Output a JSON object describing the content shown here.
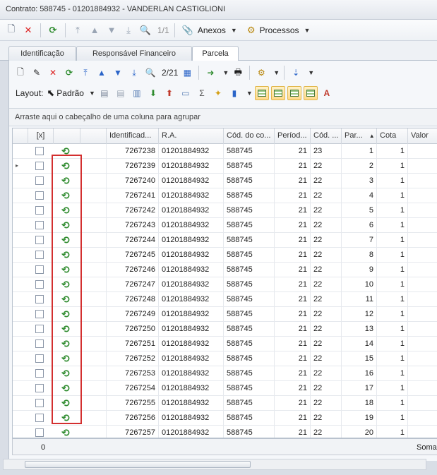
{
  "window": {
    "title": "Contrato: 588745 - 01201884932 - VANDERLAN CASTIGLIONI"
  },
  "toolbar1": {
    "counter": "1/1",
    "anexos_label": "Anexos",
    "processos_label": "Processos"
  },
  "tabs": [
    {
      "label": "Identificação"
    },
    {
      "label": "Responsável Financeiro"
    },
    {
      "label": "Parcela"
    }
  ],
  "toolbar2": {
    "counter": "2/21"
  },
  "toolbar3": {
    "layout_label": "Layout:",
    "layout_value": "Padrão"
  },
  "grid": {
    "group_hint": "Arraste aqui o cabeçalho de uma coluna para agrupar",
    "columns": [
      "[x]",
      "",
      "Identificad...",
      "R.A.",
      "Cód. do co...",
      "Períod...",
      "Cód. ...",
      "Par...",
      "Cota",
      "Valor"
    ],
    "rows": [
      {
        "id": "7267238",
        "ra": "01201884932",
        "cod": "588745",
        "per": "21",
        "cod2": "23",
        "par": "1",
        "cota": "1"
      },
      {
        "id": "7267239",
        "ra": "01201884932",
        "cod": "588745",
        "per": "21",
        "cod2": "22",
        "par": "2",
        "cota": "1"
      },
      {
        "id": "7267240",
        "ra": "01201884932",
        "cod": "588745",
        "per": "21",
        "cod2": "22",
        "par": "3",
        "cota": "1"
      },
      {
        "id": "7267241",
        "ra": "01201884932",
        "cod": "588745",
        "per": "21",
        "cod2": "22",
        "par": "4",
        "cota": "1"
      },
      {
        "id": "7267242",
        "ra": "01201884932",
        "cod": "588745",
        "per": "21",
        "cod2": "22",
        "par": "5",
        "cota": "1"
      },
      {
        "id": "7267243",
        "ra": "01201884932",
        "cod": "588745",
        "per": "21",
        "cod2": "22",
        "par": "6",
        "cota": "1"
      },
      {
        "id": "7267244",
        "ra": "01201884932",
        "cod": "588745",
        "per": "21",
        "cod2": "22",
        "par": "7",
        "cota": "1"
      },
      {
        "id": "7267245",
        "ra": "01201884932",
        "cod": "588745",
        "per": "21",
        "cod2": "22",
        "par": "8",
        "cota": "1"
      },
      {
        "id": "7267246",
        "ra": "01201884932",
        "cod": "588745",
        "per": "21",
        "cod2": "22",
        "par": "9",
        "cota": "1"
      },
      {
        "id": "7267247",
        "ra": "01201884932",
        "cod": "588745",
        "per": "21",
        "cod2": "22",
        "par": "10",
        "cota": "1"
      },
      {
        "id": "7267248",
        "ra": "01201884932",
        "cod": "588745",
        "per": "21",
        "cod2": "22",
        "par": "11",
        "cota": "1"
      },
      {
        "id": "7267249",
        "ra": "01201884932",
        "cod": "588745",
        "per": "21",
        "cod2": "22",
        "par": "12",
        "cota": "1"
      },
      {
        "id": "7267250",
        "ra": "01201884932",
        "cod": "588745",
        "per": "21",
        "cod2": "22",
        "par": "13",
        "cota": "1"
      },
      {
        "id": "7267251",
        "ra": "01201884932",
        "cod": "588745",
        "per": "21",
        "cod2": "22",
        "par": "14",
        "cota": "1"
      },
      {
        "id": "7267252",
        "ra": "01201884932",
        "cod": "588745",
        "per": "21",
        "cod2": "22",
        "par": "15",
        "cota": "1"
      },
      {
        "id": "7267253",
        "ra": "01201884932",
        "cod": "588745",
        "per": "21",
        "cod2": "22",
        "par": "16",
        "cota": "1"
      },
      {
        "id": "7267254",
        "ra": "01201884932",
        "cod": "588745",
        "per": "21",
        "cod2": "22",
        "par": "17",
        "cota": "1"
      },
      {
        "id": "7267255",
        "ra": "01201884932",
        "cod": "588745",
        "per": "21",
        "cod2": "22",
        "par": "18",
        "cota": "1"
      },
      {
        "id": "7267256",
        "ra": "01201884932",
        "cod": "588745",
        "per": "21",
        "cod2": "22",
        "par": "19",
        "cota": "1"
      },
      {
        "id": "7267257",
        "ra": "01201884932",
        "cod": "588745",
        "per": "21",
        "cod2": "22",
        "par": "20",
        "cota": "1"
      }
    ],
    "footer_count": "0",
    "footer_sum": "Soma="
  },
  "colors": {
    "highlight_border": "#d32f2f",
    "refresh_icon": "#2e8b2e"
  }
}
